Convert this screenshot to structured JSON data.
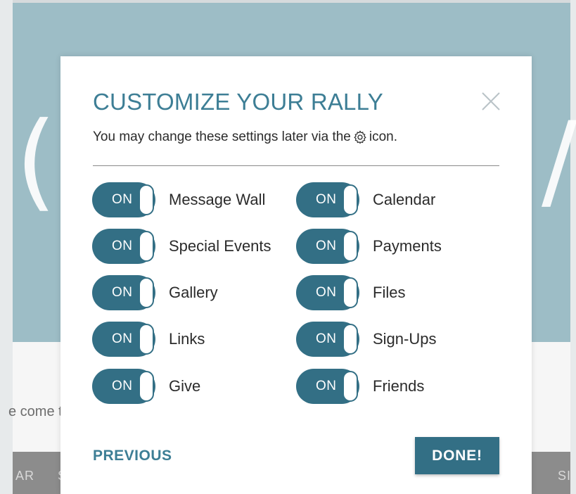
{
  "background": {
    "content_text": "e come t",
    "nav_left": "AR",
    "nav_left2": "S",
    "nav_right": "SI"
  },
  "modal": {
    "title": "CUSTOMIZE YOUR RALLY",
    "subtitle_before": "You may change these settings later via the",
    "subtitle_after": "icon.",
    "close_icon": "close-icon",
    "left_options": [
      {
        "state": "ON",
        "label": "Message Wall"
      },
      {
        "state": "ON",
        "label": "Special Events"
      },
      {
        "state": "ON",
        "label": "Gallery"
      },
      {
        "state": "ON",
        "label": "Links"
      },
      {
        "state": "ON",
        "label": "Give"
      }
    ],
    "right_options": [
      {
        "state": "ON",
        "label": "Calendar"
      },
      {
        "state": "ON",
        "label": "Payments"
      },
      {
        "state": "ON",
        "label": "Files"
      },
      {
        "state": "ON",
        "label": "Sign-Ups"
      },
      {
        "state": "ON",
        "label": "Friends"
      }
    ],
    "previous_label": "PREVIOUS",
    "done_label": "DONE!"
  },
  "colors": {
    "accent": "#336f85",
    "title": "#3d7e95",
    "hero": "#9dbdc6"
  }
}
